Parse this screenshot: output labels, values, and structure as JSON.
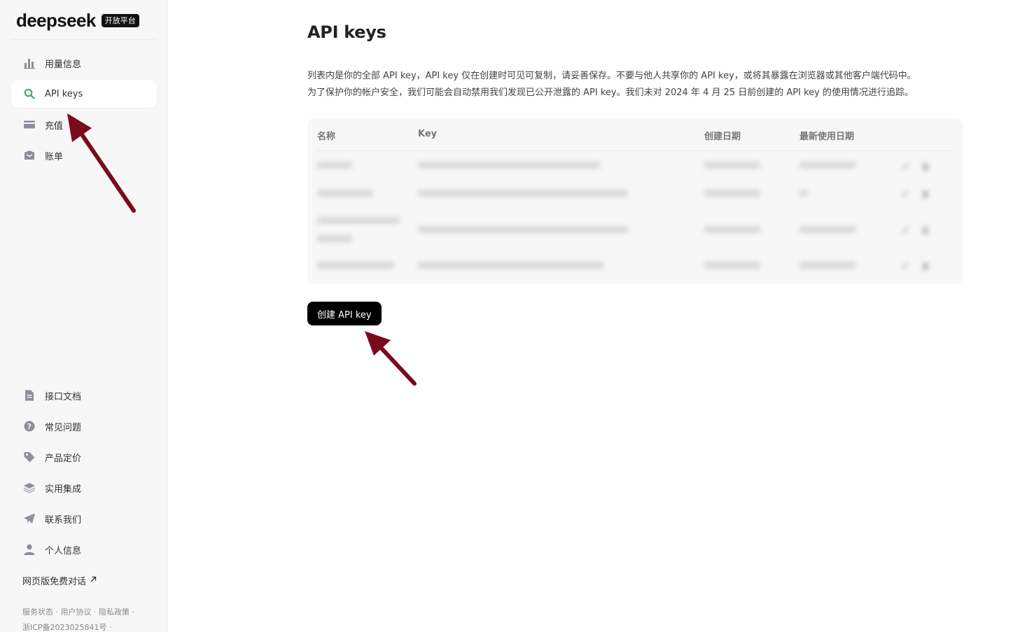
{
  "logo": {
    "text": "deepseek",
    "badge": "开放平台"
  },
  "sidebar": {
    "top_items": [
      {
        "label": "用量信息",
        "icon": "bar-chart-icon"
      },
      {
        "label": "API keys",
        "icon": "search-key-icon",
        "active": true
      },
      {
        "label": "充值",
        "icon": "card-icon"
      },
      {
        "label": "账单",
        "icon": "bill-icon"
      }
    ],
    "bottom_items": [
      {
        "label": "接口文档",
        "icon": "document-icon"
      },
      {
        "label": "常见问题",
        "icon": "question-icon"
      },
      {
        "label": "产品定价",
        "icon": "tag-icon"
      },
      {
        "label": "实用集成",
        "icon": "layers-icon"
      },
      {
        "label": "联系我们",
        "icon": "send-icon"
      },
      {
        "label": "个人信息",
        "icon": "user-icon"
      }
    ],
    "web_chat": "网页版免费对话",
    "footer_line1": "服务状态 · 用户协议 · 隐私政策 ·",
    "footer_line2": "浙ICP备2023025841号 ·"
  },
  "main": {
    "title": "API keys",
    "desc_line1": "列表内是你的全部 API key，API key 仅在创建时可见可复制，请妥善保存。不要与他人共享你的 API key，或将其暴露在浏览器或其他客户端代码中。",
    "desc_line2": "为了保护你的帐户安全，我们可能会自动禁用我们发现已公开泄露的 API key。我们未对 2024 年 4 月 25 日前创建的 API key 的使用情况进行追踪。",
    "table": {
      "headers": {
        "name": "名称",
        "key": "Key",
        "created": "创建日期",
        "last_used": "最新使用日期"
      }
    },
    "create_button": "创建 API key"
  },
  "colors": {
    "accent_green": "#3daa5c",
    "arrow": "#7a0a1e"
  }
}
